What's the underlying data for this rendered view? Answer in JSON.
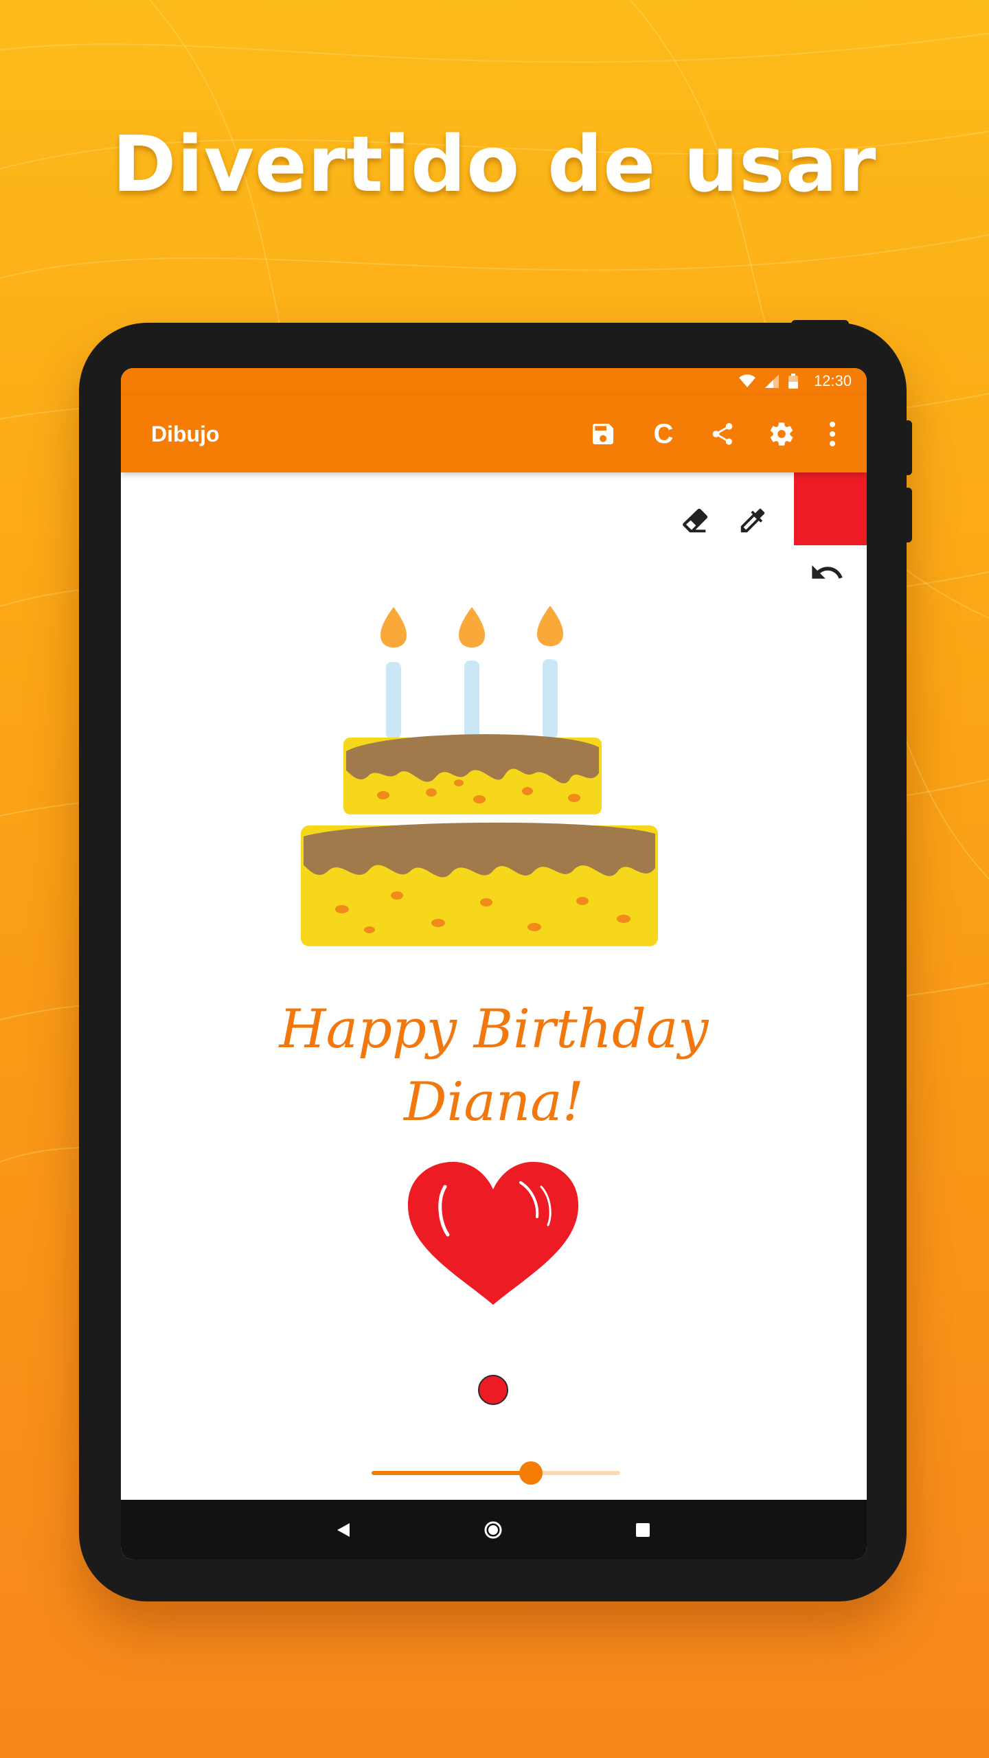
{
  "headline": "Divertido de usar",
  "status_bar": {
    "time": "12:30",
    "icons": [
      "wifi-icon",
      "signal-icon",
      "battery-icon"
    ]
  },
  "app_bar": {
    "title": "Dibujo",
    "actions": [
      "save-icon",
      "C",
      "share-icon",
      "settings-icon",
      "more-vert-icon"
    ],
    "redo_label": "C"
  },
  "canvas": {
    "tools": [
      "eraser-icon",
      "eyedropper-icon",
      "undo-icon"
    ],
    "current_color": "#ed1c24",
    "drawing_text_line1": "Happy Birthday",
    "drawing_text_line2": "Diana!",
    "brush_size_fraction": 0.64
  },
  "nav_bar": [
    "back-icon",
    "home-icon",
    "recents-icon"
  ],
  "colors": {
    "accent": "#f57c05",
    "background_top": "#fdbb1a",
    "background_bottom": "#f7861b",
    "text_drawing": "#f2780e",
    "heart": "#ed1c24"
  }
}
